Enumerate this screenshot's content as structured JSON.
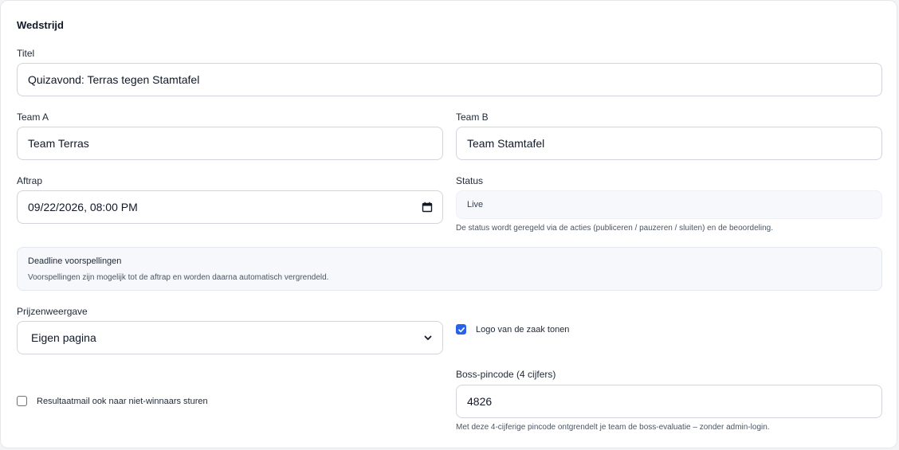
{
  "section": {
    "title": "Wedstrijd"
  },
  "titel": {
    "label": "Titel",
    "value": "Quizavond: Terras tegen Stamtafel"
  },
  "team_a": {
    "label": "Team A",
    "value": "Team Terras"
  },
  "team_b": {
    "label": "Team B",
    "value": "Team Stamtafel"
  },
  "aftrap": {
    "label": "Aftrap",
    "value": "09/22/2026, 08:00 PM"
  },
  "status": {
    "label": "Status",
    "value": "Live",
    "hint": "De status wordt geregeld via de acties (publiceren / pauzeren / sluiten) en de beoordeling."
  },
  "deadline": {
    "title": "Deadline voorspellingen",
    "text": "Voorspellingen zijn mogelijk tot de aftrap en worden daarna automatisch vergrendeld."
  },
  "prijzen": {
    "label": "Prijzenweergave",
    "selected": "Eigen pagina"
  },
  "logo": {
    "label": "Logo van de zaak tonen",
    "checked": true
  },
  "resultaatmail": {
    "label": "Resultaatmail ook naar niet-winnaars sturen",
    "checked": false
  },
  "pincode": {
    "label": "Boss-pincode (4 cijfers)",
    "value": "4826",
    "hint": "Met deze 4-cijferige pincode ontgrendelt je team de boss-evaluatie – zonder admin-login."
  },
  "colors": {
    "accent": "#2563eb",
    "border": "#d1d5db",
    "muted_bg": "#f6f8fb"
  }
}
